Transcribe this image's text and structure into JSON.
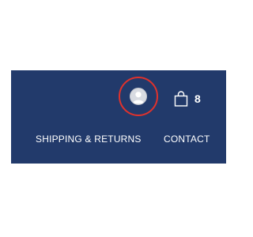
{
  "header": {
    "account": {
      "icon": "user-avatar-icon",
      "highlight_color": "#e0322c"
    },
    "cart": {
      "icon": "shopping-bag-icon",
      "count": "8"
    },
    "nav": {
      "shipping_returns": "SHIPPING & RETURNS",
      "contact": "CONTACT"
    },
    "colors": {
      "background": "#223a6b",
      "text": "#ffffff"
    }
  }
}
